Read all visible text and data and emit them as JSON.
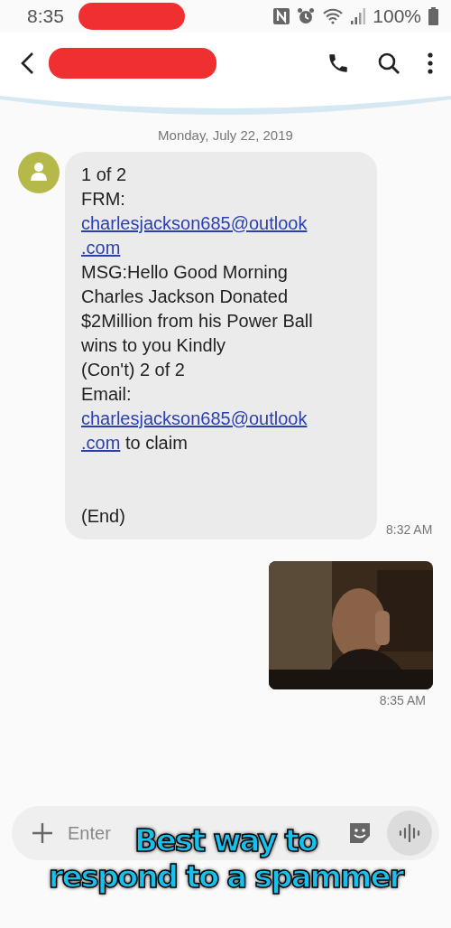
{
  "status_bar": {
    "time": "8:35",
    "battery": "100%"
  },
  "header": {
    "redacted": true
  },
  "date_divider": "Monday, July 22, 2019",
  "messages": [
    {
      "kind": "received",
      "lines": [
        [
          {
            "kind": "text",
            "text": " 1 of 2"
          }
        ],
        [
          {
            "kind": "text",
            "text": "FRM:"
          }
        ],
        [
          {
            "kind": "link",
            "text": "charlesjackson685@outlook"
          }
        ],
        [
          {
            "kind": "link",
            "text": ".com"
          }
        ],
        [
          {
            "kind": "text",
            "text": "MSG:Hello Good Morning"
          }
        ],
        [
          {
            "kind": "text",
            "text": "Charles Jackson Donated"
          }
        ],
        [
          {
            "kind": "text",
            "text": "$2Million from his Power Ball"
          }
        ],
        [
          {
            "kind": "text",
            "text": "wins to you Kindly"
          }
        ],
        [
          {
            "kind": "text",
            "text": "(Con't) 2 of 2"
          }
        ],
        [
          {
            "kind": "text",
            "text": "Email:"
          }
        ],
        [
          {
            "kind": "link",
            "text": "charlesjackson685@outlook"
          }
        ],
        [
          {
            "kind": "link",
            "text": ".com"
          },
          {
            "kind": "text",
            "text": " to claim"
          }
        ]
      ],
      "footer": "(End)",
      "time": "8:32 AM"
    },
    {
      "kind": "sent",
      "time": "8:35 AM"
    }
  ],
  "composer": {
    "placeholder": "Enter"
  },
  "caption": [
    "Best way to",
    "respond to a spammer"
  ]
}
